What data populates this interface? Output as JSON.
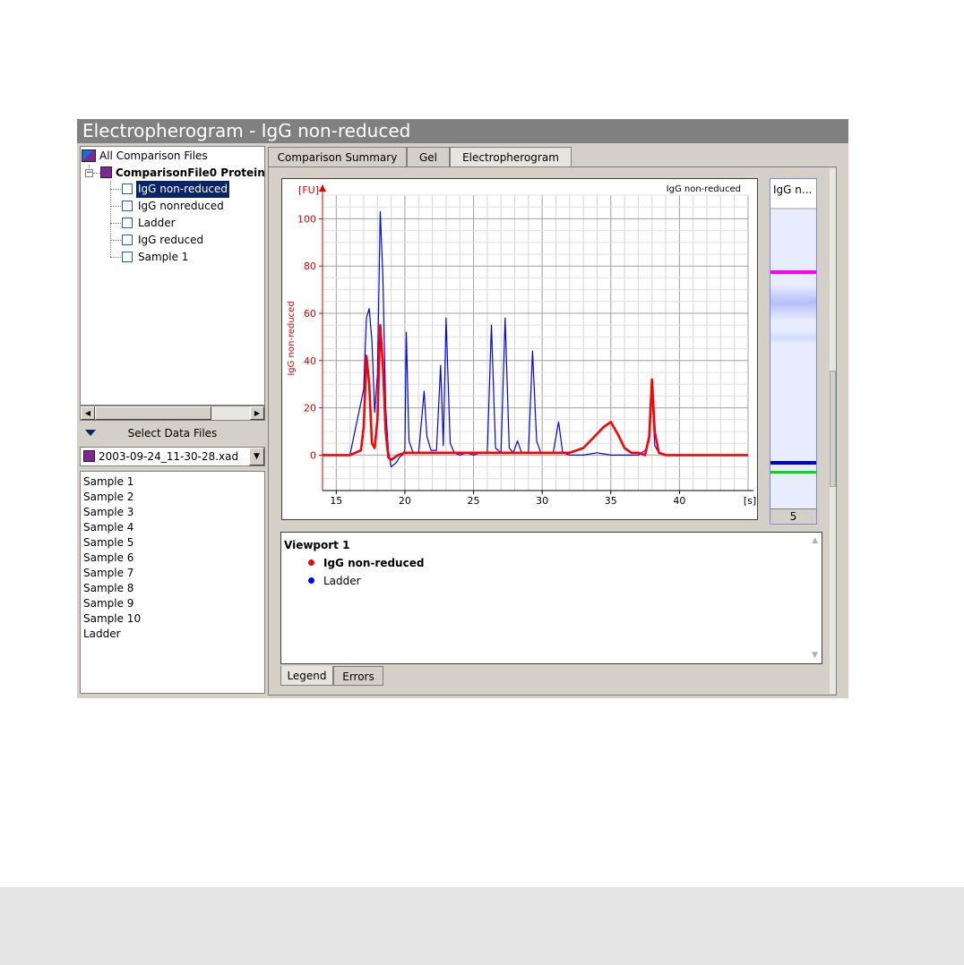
{
  "window": {
    "title": "Electropherogram - IgG non-reduced"
  },
  "tree": {
    "root_label": "All Comparison Files",
    "file_label": "ComparisonFile0 Protein",
    "items": [
      {
        "label": "IgG non-reduced",
        "selected": true
      },
      {
        "label": "IgG nonreduced",
        "selected": false
      },
      {
        "label": "Ladder",
        "selected": false
      },
      {
        "label": "IgG reduced",
        "selected": false
      },
      {
        "label": "Sample 1",
        "selected": false
      }
    ]
  },
  "data_files": {
    "header_label": "Select Data Files",
    "selected_file": "2003-09-24_11-30-28.xad",
    "samples": [
      "Sample 1",
      "Sample 2",
      "Sample 3",
      "Sample 4",
      "Sample 5",
      "Sample 6",
      "Sample 7",
      "Sample 8",
      "Sample 9",
      "Sample 10",
      "Ladder"
    ]
  },
  "tabs": [
    {
      "label": "Comparison Summary",
      "active": false
    },
    {
      "label": "Gel",
      "active": false
    },
    {
      "label": "Electropherogram",
      "active": true
    }
  ],
  "gel_lane": {
    "header": "IgG n...",
    "footer": "5"
  },
  "legend": {
    "title": "Viewport 1",
    "entries": [
      {
        "label": "IgG non-reduced",
        "color": "#ff0000",
        "bold": true
      },
      {
        "label": "Ladder",
        "color": "#0000ff",
        "bold": false
      }
    ]
  },
  "bottom_tabs": [
    {
      "label": "Legend",
      "active": true
    },
    {
      "label": "Errors",
      "active": false
    }
  ],
  "colors": {
    "red_series": "#ff0000",
    "blue_series": "#1a1aff",
    "axis_label": "#e00000",
    "gel_magenta": "#ff00ff",
    "gel_green": "#00e000",
    "gel_blue": "#0000cc"
  },
  "chart_data": {
    "type": "line",
    "title": "IgG non-reduced",
    "ylabel": "IgG non-reduced",
    "y_unit": "[FU]",
    "x_unit": "[s]",
    "xlim": [
      14,
      45
    ],
    "ylim": [
      -15,
      110
    ],
    "x_ticks": [
      15,
      20,
      25,
      30,
      35,
      40
    ],
    "y_ticks": [
      0,
      20,
      40,
      60,
      80,
      100
    ],
    "grid": true,
    "series": [
      {
        "name": "IgG non-reduced",
        "color": "#ff0000",
        "x": [
          14.0,
          15.0,
          16.0,
          16.8,
          17.0,
          17.2,
          17.4,
          17.6,
          17.8,
          18.0,
          18.2,
          18.4,
          18.6,
          18.8,
          19.0,
          19.5,
          20,
          21,
          22,
          23,
          24,
          25,
          26,
          27,
          28,
          29,
          30,
          31,
          32,
          32.5,
          33,
          33.5,
          34,
          34.5,
          35,
          35.5,
          36,
          36.5,
          37,
          37.5,
          37.8,
          38.0,
          38.2,
          38.5,
          39,
          40,
          42,
          45
        ],
        "y": [
          0,
          0,
          0,
          2,
          12,
          42,
          30,
          5,
          3,
          15,
          55,
          38,
          10,
          -1,
          -2,
          0,
          1,
          1,
          1,
          1,
          1,
          1,
          1,
          1,
          1,
          1,
          1,
          1,
          1,
          2,
          3,
          6,
          9,
          12,
          14,
          9,
          3,
          1,
          1,
          0,
          8,
          32,
          10,
          1,
          0,
          0,
          0,
          0
        ]
      },
      {
        "name": "Ladder",
        "color": "#0000ff",
        "x": [
          14.0,
          15.0,
          16.0,
          17.0,
          17.2,
          17.4,
          17.6,
          17.8,
          18.0,
          18.2,
          18.4,
          18.6,
          18.8,
          19.0,
          19.2,
          19.4,
          19.6,
          19.8,
          20,
          20.1,
          20.3,
          20.6,
          21,
          21.4,
          21.6,
          21.9,
          22.3,
          22.6,
          22.8,
          23.0,
          23.3,
          23.6,
          24,
          24.5,
          25,
          25.5,
          26,
          26.3,
          26.6,
          27,
          27.3,
          27.6,
          27.9,
          28.2,
          28.5,
          29,
          29.3,
          29.6,
          29.9,
          30.3,
          30.8,
          31.2,
          31.5,
          32,
          33,
          34,
          35,
          36,
          37,
          37.5,
          37.8,
          38.0,
          38.2,
          38.5,
          39,
          40,
          42,
          45
        ],
        "y": [
          0,
          0,
          0,
          28,
          58,
          62,
          48,
          18,
          34,
          103,
          75,
          20,
          2,
          -5,
          -4,
          -3,
          -1,
          0,
          2,
          52,
          6,
          1,
          1,
          27,
          8,
          2,
          2,
          38,
          4,
          58,
          5,
          1,
          0,
          1,
          0,
          1,
          1,
          55,
          3,
          1,
          58,
          3,
          1,
          6,
          1,
          1,
          44,
          6,
          1,
          1,
          1,
          14,
          1,
          0,
          0,
          1,
          0,
          0,
          0,
          2,
          6,
          27,
          4,
          1,
          0,
          0,
          0,
          0
        ]
      }
    ]
  }
}
